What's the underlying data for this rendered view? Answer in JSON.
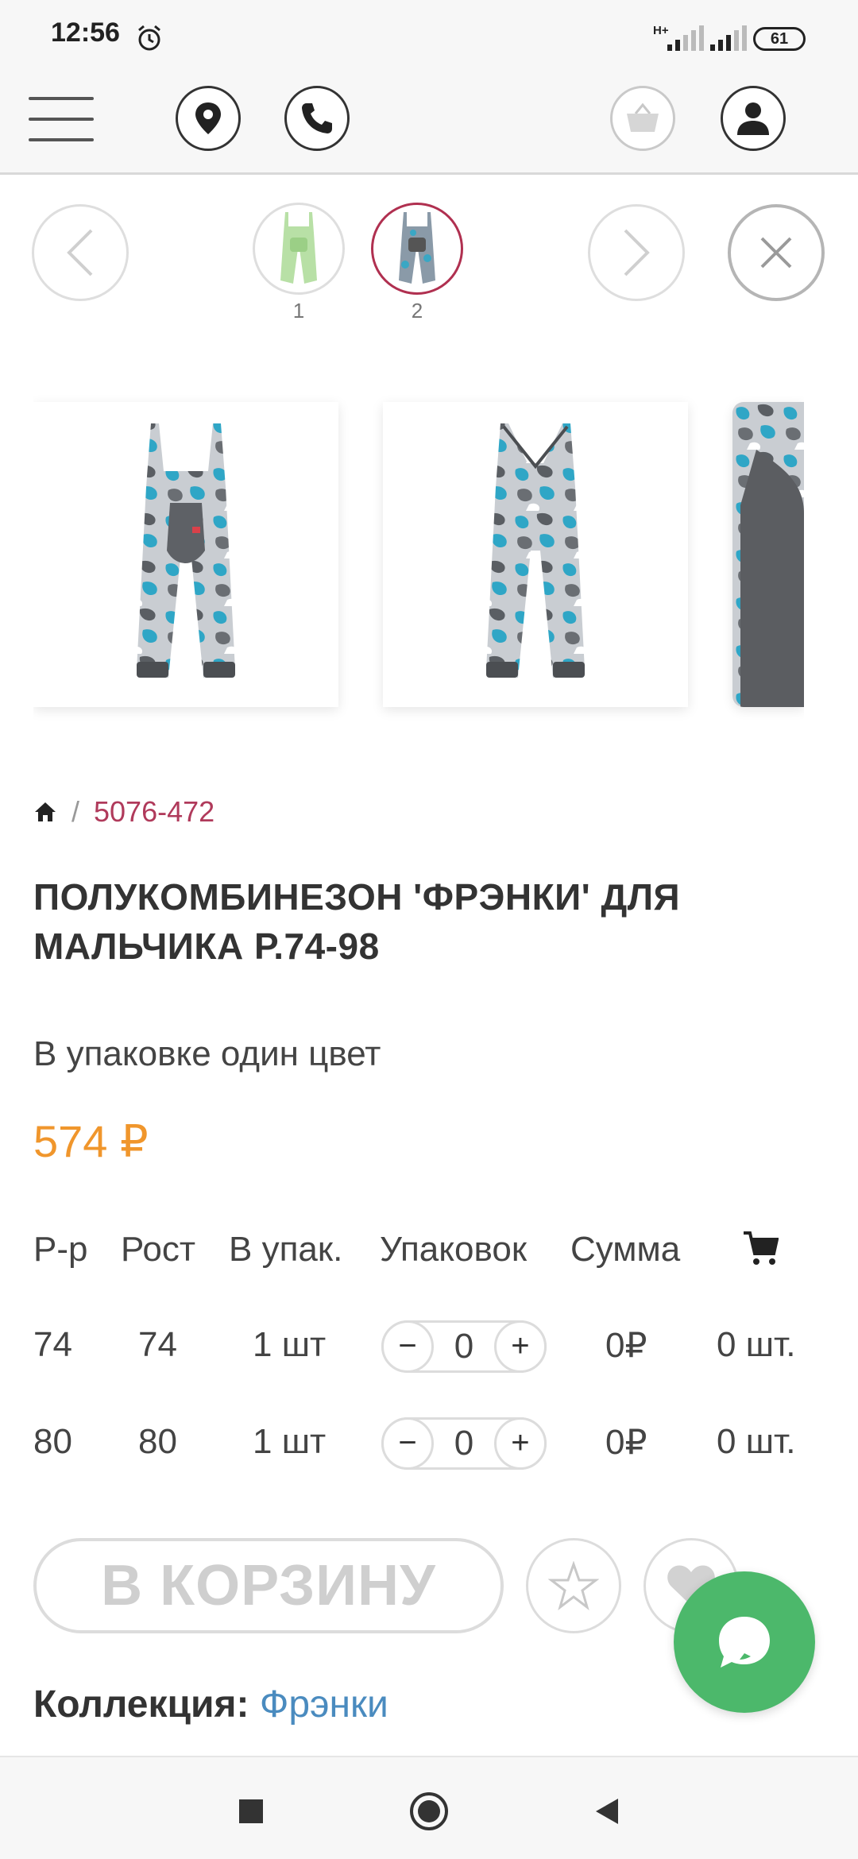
{
  "status_bar": {
    "time": "12:56",
    "network": "H+",
    "battery": "61"
  },
  "header": {
    "menu_icon": "hamburger-icon",
    "location_icon": "map-pin-icon",
    "phone_icon": "phone-icon",
    "basket_icon": "basket-icon",
    "user_icon": "user-icon"
  },
  "navigation": {
    "thumbnails": [
      {
        "number": "1",
        "color": "light-green"
      },
      {
        "number": "2",
        "color": "blue-camouflage",
        "active": true
      }
    ]
  },
  "gallery": {
    "images": [
      "overalls-front",
      "overalls-back",
      "overalls-detail"
    ]
  },
  "breadcrumb": {
    "home_icon": "home-icon",
    "separator": "/",
    "current": "5076-472"
  },
  "product": {
    "title": "ПОЛУКОМБИНЕЗОН 'ФРЭНКИ' ДЛЯ МАЛЬЧИКА Р.74-98",
    "pack_note": "В упаковке один цвет",
    "price": "574 ₽",
    "price_color": "#f0962c"
  },
  "table": {
    "headers": {
      "size": "Р-р",
      "height": "Рост",
      "per_pack": "В упак.",
      "packs": "Упаковок",
      "sum": "Сумма",
      "cart_icon": "cart-icon"
    },
    "rows": [
      {
        "size": "74",
        "height": "74",
        "per_pack": "1 шт",
        "qty": "0",
        "sum": "0₽",
        "count": "0 шт."
      },
      {
        "size": "80",
        "height": "80",
        "per_pack": "1 шт",
        "qty": "0",
        "sum": "0₽",
        "count": "0 шт."
      }
    ],
    "minus": "−",
    "plus": "+"
  },
  "actions": {
    "add_to_cart": "В КОРЗИНУ",
    "star_icon": "star-icon",
    "heart_icon": "heart-icon",
    "chat_icon": "chat-bubble-icon"
  },
  "collection": {
    "label": "Коллекция:",
    "value": "Фрэнки"
  },
  "system_nav": {
    "recent": "square-icon",
    "home": "circle-icon",
    "back": "triangle-back-icon"
  }
}
